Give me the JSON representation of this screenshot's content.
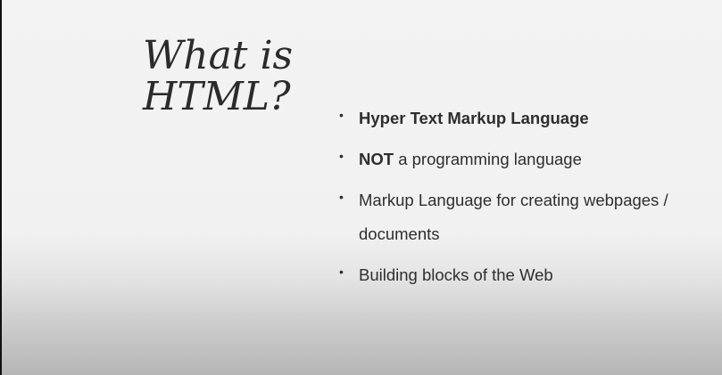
{
  "slide": {
    "title_line1": "What is",
    "title_line2": "HTML?",
    "bullets": [
      {
        "bold": "Hyper Text Markup Language",
        "rest": ""
      },
      {
        "bold": "NOT",
        "rest": " a programming language"
      },
      {
        "bold": "",
        "rest": "Markup Language for creating webpages / documents"
      },
      {
        "bold": "",
        "rest": "Building blocks of the Web"
      }
    ],
    "bullet_glyph": "•"
  }
}
